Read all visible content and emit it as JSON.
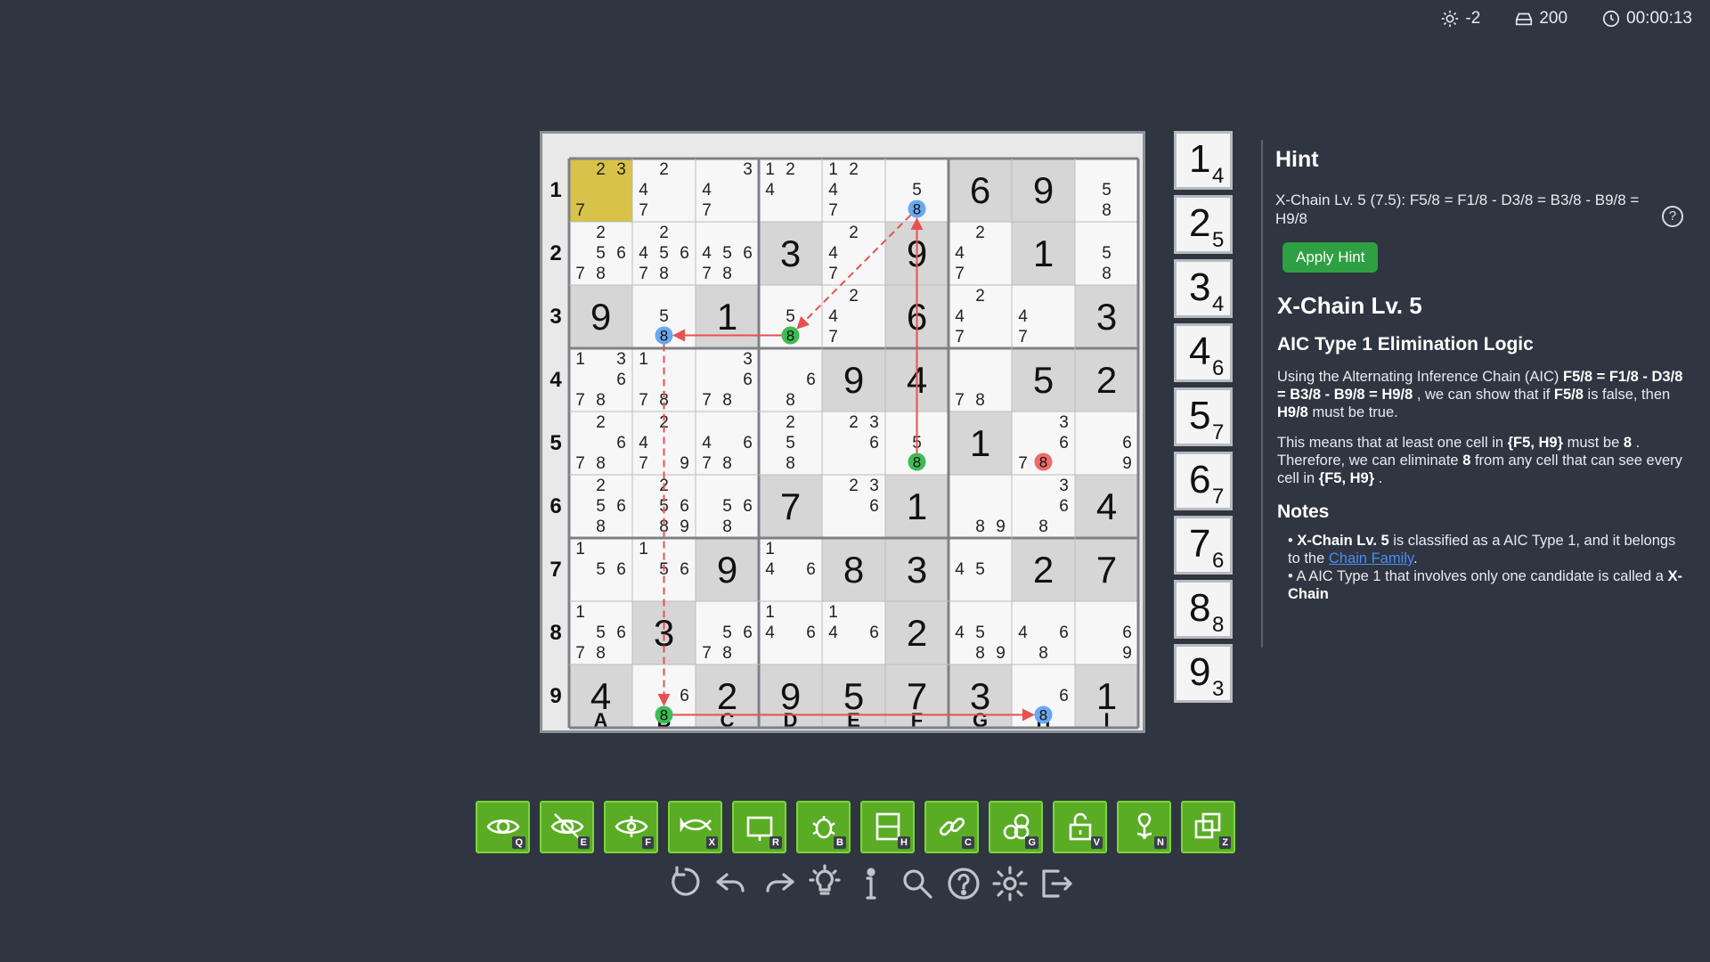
{
  "status": {
    "brightness": "-2",
    "score": "200",
    "timer": "00:00:13"
  },
  "board": {
    "row_labels": [
      "1",
      "2",
      "3",
      "4",
      "5",
      "6",
      "7",
      "8",
      "9"
    ],
    "col_labels": [
      "A",
      "B",
      "C",
      "D",
      "E",
      "F",
      "G",
      "H",
      "I"
    ],
    "highlight_cell": "A1",
    "cells": [
      [
        "c:23 7",
        "c:2 4 7",
        "c:3 4 7",
        "c:12 4",
        "c:12 4 7",
        "c:5 8",
        "g:6",
        "g:9",
        "c:5 8"
      ],
      [
        "c:2 56 78",
        "c:2 456 78",
        "c:456 78",
        "g:3",
        "c:2 4 7",
        "g:9",
        "c:2 4 7",
        "g:1",
        "c:5 8"
      ],
      [
        "g:9",
        "c:5 8",
        "g:1",
        "c:5 8",
        "c:2 4 7",
        "g:6",
        "c:2 4 7",
        "c:4 7",
        "g:3"
      ],
      [
        "c:13 6 78",
        "c:1 78",
        "c:3 6 78",
        "c:6 8",
        "g:9",
        "g:4",
        "c:78",
        "g:5",
        "g:2"
      ],
      [
        "c:2 6 78",
        "c:2 4 7 9",
        "c:46 78",
        "c:2 5 8",
        "c:23 6",
        "c:5 8",
        "g:1",
        "c:3 6 78",
        "c:6 9"
      ],
      [
        "c:2 56 8",
        "c:2 56 89",
        "c:56 8",
        "g:7",
        "c:23 6",
        "g:1",
        "c:89",
        "c:3 6 8",
        "g:4"
      ],
      [
        "c:1 56",
        "c:1 56",
        "g:9",
        "c:1 4 6",
        "g:8",
        "g:3",
        "c:45",
        "g:2",
        "g:7"
      ],
      [
        "c:1 56 78",
        "g:3",
        "c:56 78",
        "c:1 4 6",
        "c:1 4 6",
        "g:2",
        "c:45 89",
        "c:4 6 8",
        "c:6 9"
      ],
      [
        "g:4",
        "c:6 8",
        "g:2",
        "g:9",
        "g:5",
        "g:7",
        "g:3",
        "c:6 8",
        "g:1"
      ]
    ],
    "markers": [
      {
        "cell": "F1",
        "digit": "8",
        "color": "#6aa8f0"
      },
      {
        "cell": "D3",
        "digit": "8",
        "color": "#3dbb55"
      },
      {
        "cell": "B3",
        "digit": "8",
        "color": "#6aa8f0"
      },
      {
        "cell": "F5",
        "digit": "8",
        "color": "#3dbb55"
      },
      {
        "cell": "B9",
        "digit": "8",
        "color": "#3dbb55"
      },
      {
        "cell": "H9",
        "digit": "8",
        "color": "#6aa8f0"
      },
      {
        "cell": "H5",
        "digit": "8",
        "color": "#ef6b6b"
      }
    ],
    "links": [
      {
        "from": "F5",
        "to": "F1",
        "style": "solid"
      },
      {
        "from": "F1",
        "to": "D3",
        "style": "dashed"
      },
      {
        "from": "D3",
        "to": "B3",
        "style": "solid"
      },
      {
        "from": "B3",
        "to": "B9",
        "style": "dashed"
      },
      {
        "from": "B9",
        "to": "H9",
        "style": "solid"
      }
    ]
  },
  "digit_counts": [
    {
      "digit": "1",
      "count": "4"
    },
    {
      "digit": "2",
      "count": "5"
    },
    {
      "digit": "3",
      "count": "4"
    },
    {
      "digit": "4",
      "count": "6"
    },
    {
      "digit": "5",
      "count": "7"
    },
    {
      "digit": "6",
      "count": "7"
    },
    {
      "digit": "7",
      "count": "6"
    },
    {
      "digit": "8",
      "count": "8"
    },
    {
      "digit": "9",
      "count": "3"
    }
  ],
  "hint": {
    "title": "Hint",
    "text": "X-Chain Lv. 5 (7.5): F5/8 = F1/8 - D3/8 = B3/8 - B9/8 = H9/8",
    "help_symbol": "?",
    "apply_label": "Apply Hint",
    "technique": "X-Chain Lv. 5",
    "subtitle": "AIC Type 1 Elimination Logic",
    "p1_a": "Using the Alternating Inference Chain (AIC) ",
    "p1_chain": "F5/8 = F1/8 - D3/8 = B3/8 - B9/8 = H9/8",
    "p1_b": " , we can show that if ",
    "p1_f5": "F5/8",
    "p1_c": " is false, then ",
    "p1_h9": "H9/8",
    "p1_d": " must be true.",
    "p2_a": "This means that at least one cell in ",
    "p2_set": "{F5, H9}",
    "p2_b": " must be ",
    "p2_digit": "8",
    "p2_c": " . Therefore, we can eliminate ",
    "p2_digit2": "8",
    "p2_d": " from any cell that can see every cell in ",
    "p2_set2": "{F5, H9}",
    "p2_e": " .",
    "notes_title": "Notes",
    "n1_tech": "X-Chain Lv. 5",
    "n1_a": " is classified as a AIC Type 1, and it belongs to the ",
    "n1_link": "Chain Family",
    "n1_b": ".",
    "n2_a": "A AIC Type 1 that involves only one candidate is called a ",
    "n2_b": "X-Chain"
  },
  "tools": [
    {
      "icon": "eye-icon",
      "key": "Q"
    },
    {
      "icon": "eye-off-icon",
      "key": "E"
    },
    {
      "icon": "eye-focus-icon",
      "key": "F"
    },
    {
      "icon": "fish-icon",
      "key": "X"
    },
    {
      "icon": "rectangle-icon",
      "key": "R"
    },
    {
      "icon": "bug-icon",
      "key": "B"
    },
    {
      "icon": "house-icon",
      "key": "H"
    },
    {
      "icon": "chain-icon",
      "key": "C"
    },
    {
      "icon": "chain-group-icon",
      "key": "G"
    },
    {
      "icon": "unlock-icon",
      "key": "V"
    },
    {
      "icon": "flower-icon",
      "key": "N"
    },
    {
      "icon": "overlap-icon",
      "key": "Z"
    }
  ],
  "bottom_icons": [
    "reset-icon",
    "undo-icon",
    "redo-icon",
    "lightbulb-icon",
    "info-icon",
    "search-icon",
    "help-icon",
    "settings-icon",
    "exit-icon"
  ],
  "colors": {
    "background": "#2f3541",
    "tool_green": "#5aac25",
    "apply_green": "#2ea043",
    "highlight": "#d8c24a",
    "link_red": "#e85050"
  }
}
